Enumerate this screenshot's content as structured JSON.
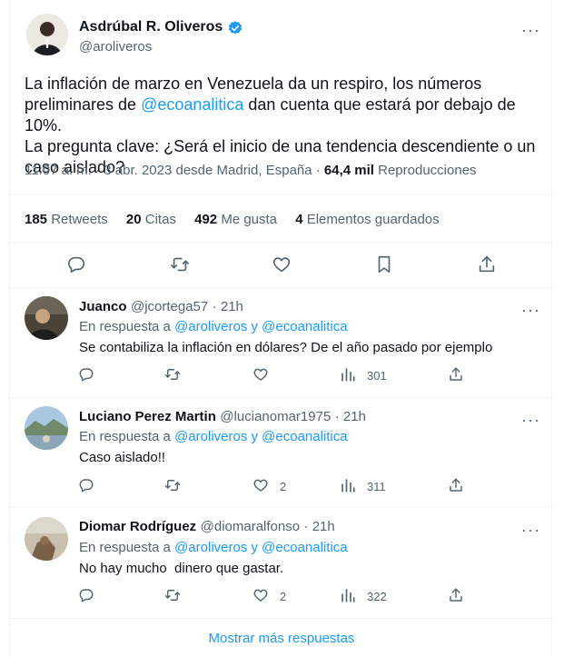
{
  "main_tweet": {
    "display_name": "Asdrúbal R. Oliveros",
    "handle": "@aroliveros",
    "text_line1": "La inflación de marzo en Venezuela da un respiro, los números",
    "text_line2_pre": "preliminares de ",
    "text_line2_mention": "@ecoanalitica",
    "text_line2_post": " dan cuenta que estará por debajo de 10%.",
    "text_line3": "La pregunta clave: ¿Será el inicio de una tendencia descendiente o un",
    "text_line4": "caso aislado?",
    "timestamp": "11:07 a. m. · 3 abr. 2023 desde Madrid, España · ",
    "views_count": "64,4 mil",
    "views_label": " Reproducciones",
    "retweets_count": "185",
    "retweets_label": "Retweets",
    "quotes_count": "20",
    "quotes_label": "Citas",
    "likes_count": "492",
    "likes_label": "Me gusta",
    "bookmarks_count": "4",
    "bookmarks_label": "Elementos guardados"
  },
  "replies": [
    {
      "display_name": "Juanco",
      "handle": "@jcortega57",
      "time": "· 21h",
      "reply_prefix": "En respuesta a ",
      "reply_targets": "@aroliveros y @ecoanalitica",
      "text": "Se contabiliza la inflación en dólares? De el año pasado por ejemplo",
      "likes": "",
      "views": "301"
    },
    {
      "display_name": "Luciano Perez Martin",
      "handle": "@lucianomar1975",
      "time": "· 21h",
      "reply_prefix": "En respuesta a ",
      "reply_targets": "@aroliveros y @ecoanalitica",
      "text": "Caso aislado!!",
      "likes": "2",
      "views": "311"
    },
    {
      "display_name": "Diomar Rodríguez",
      "handle": "@diomaralfonso",
      "time": "· 21h",
      "reply_prefix": "En respuesta a ",
      "reply_targets": "@aroliveros y @ecoanalitica",
      "text": "No hay mucho  dinero que gastar.",
      "likes": "2",
      "views": "322"
    }
  ],
  "show_more_label": "Mostrar más respuestas",
  "more_glyph": "···",
  "colors": {
    "accent": "#1d9bf0",
    "text": "#0f1419",
    "muted": "#536471",
    "border": "#eff3f4"
  }
}
